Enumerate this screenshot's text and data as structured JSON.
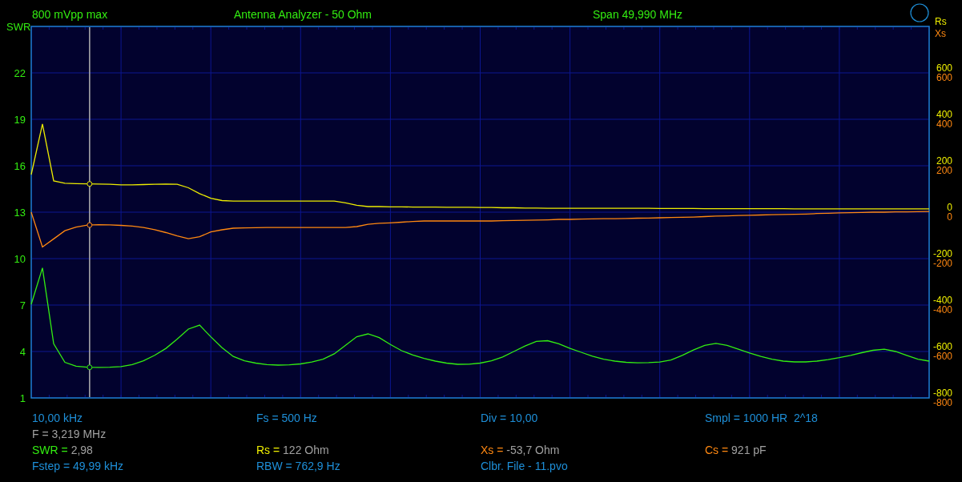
{
  "analyzer": {
    "amplitude": "800 mVpp max",
    "title": "Antenna Analyzer - 50 Ohm",
    "span": "Span 49,990 MHz",
    "cursor": {
      "level": 0.065
    },
    "swr_chart": {
      "chart_data": {
        "type": "line",
        "categories": [
          null,
          null,
          null,
          null,
          null,
          null,
          null,
          null,
          null,
          null,
          null,
          null,
          null,
          null,
          null,
          null,
          null,
          null,
          null,
          null,
          null,
          null,
          null,
          null,
          null,
          null,
          null,
          null,
          null,
          null,
          null,
          null,
          null,
          null,
          null,
          null,
          null,
          null,
          null,
          null,
          null,
          null,
          null,
          null,
          null,
          null,
          null,
          null,
          null,
          null,
          null,
          null,
          null,
          null,
          null,
          null,
          null,
          null,
          null,
          null,
          null,
          null,
          null,
          null,
          null,
          null,
          null,
          null,
          null,
          null,
          null,
          null,
          null,
          null,
          null,
          null,
          null,
          null,
          null,
          null,
          null
        ],
        "ylim": [
          1,
          25
        ],
        "yticks": [
          1,
          4,
          7,
          10,
          13,
          16,
          19,
          22
        ],
        "series": [
          {
            "name": "SWR",
            "color": "#33ee11",
            "values": [
              7.05,
              9.4,
              4.5,
              3.3,
              3.05,
              2.98,
              2.97,
              2.98,
              3.02,
              3.15,
              3.4,
              3.75,
              4.2,
              4.8,
              5.45,
              5.7,
              4.95,
              4.25,
              3.68,
              3.4,
              3.25,
              3.15,
              3.12,
              3.14,
              3.2,
              3.32,
              3.5,
              3.85,
              4.4,
              4.95,
              5.14,
              4.9,
              4.45,
              4.05,
              3.78,
              3.55,
              3.38,
              3.25,
              3.17,
              3.18,
              3.25,
              3.4,
              3.65,
              4.0,
              4.35,
              4.65,
              4.7,
              4.5,
              4.2,
              3.95,
              3.7,
              3.5,
              3.38,
              3.3,
              3.27,
              3.28,
              3.32,
              3.45,
              3.75,
              4.1,
              4.4,
              4.52,
              4.4,
              4.15,
              3.9,
              3.68,
              3.5,
              3.38,
              3.33,
              3.33,
              3.38,
              3.48,
              3.6,
              3.75,
              3.92,
              4.08,
              4.15,
              4.0,
              3.75,
              3.5,
              3.38
            ]
          }
        ]
      }
    },
    "impedance_chart": {
      "xs_tick_labels": [
        "600",
        "400",
        "200",
        "0",
        "-200",
        "-400",
        "-600",
        "-800"
      ],
      "chart_data": {
        "type": "line",
        "categories": [
          null,
          null,
          null,
          null,
          null,
          null,
          null,
          null,
          null,
          null,
          null,
          null,
          null,
          null,
          null,
          null,
          null,
          null,
          null,
          null,
          null,
          null,
          null,
          null,
          null,
          null,
          null,
          null,
          null,
          null,
          null,
          null,
          null,
          null,
          null,
          null,
          null,
          null,
          null,
          null,
          null,
          null,
          null,
          null,
          null,
          null,
          null,
          null,
          null,
          null,
          null,
          null,
          null,
          null,
          null,
          null,
          null,
          null,
          null,
          null,
          null,
          null,
          null,
          null,
          null,
          null,
          null,
          null,
          null,
          null,
          null,
          null,
          null,
          null,
          null,
          null,
          null,
          null,
          null,
          null,
          null
        ],
        "ylim": [
          -800,
          800
        ],
        "yticks": [
          -800,
          -600,
          -400,
          -200,
          0,
          200,
          400,
          600
        ],
        "series": [
          {
            "name": "Rs",
            "color": "#eeee00",
            "values": [
              162,
              380,
              135,
              125,
              123,
              122,
              121,
              120,
              118,
              118,
              119,
              120,
              121,
              120,
              105,
              80,
              60,
              50,
              48,
              48,
              48,
              48,
              48,
              48,
              48,
              48,
              48,
              48,
              40,
              30,
              24,
              24,
              23,
              23,
              22,
              22,
              22,
              21,
              21,
              21,
              20,
              20,
              19,
              19,
              18,
              18,
              17,
              17,
              17,
              17,
              17,
              17,
              17,
              17,
              17,
              17,
              16,
              16,
              16,
              16,
              15,
              15,
              15,
              15,
              15,
              15,
              15,
              15,
              14,
              14,
              14,
              14,
              14,
              14,
              14,
              14,
              14,
              14,
              14,
              14,
              14
            ]
          },
          {
            "name": "Xs",
            "color": "#ff8811",
            "values": [
              0,
              -150,
              -115,
              -80,
              -64,
              -56,
              -54,
              -55,
              -57,
              -60,
              -66,
              -75,
              -88,
              -102,
              -114,
              -106,
              -85,
              -76,
              -69,
              -68,
              -67,
              -66,
              -66,
              -66,
              -66,
              -66,
              -66,
              -66,
              -66,
              -62,
              -52,
              -48,
              -46,
              -43,
              -40,
              -38,
              -38,
              -38,
              -38,
              -38,
              -38,
              -38,
              -37,
              -36,
              -35,
              -34,
              -33,
              -31,
              -31,
              -30,
              -29,
              -28,
              -28,
              -27,
              -26,
              -25,
              -24,
              -23,
              -22,
              -21,
              -19,
              -17,
              -16,
              -14,
              -13,
              -12,
              -11,
              -10,
              -9,
              -8,
              -6,
              -5,
              -3,
              -2,
              -1,
              0,
              0,
              1,
              1,
              2,
              3
            ]
          }
        ]
      }
    }
  },
  "readouts": [
    [
      {
        "kind": "info",
        "text": "10,00 kHz"
      },
      {
        "kind": "info",
        "text": "Fs = 500 Hz"
      },
      {
        "kind": "info",
        "text": "Div = 10,00"
      },
      {
        "kind": "info",
        "text": "Smpl = 1000 HR  2^18"
      }
    ],
    [
      {
        "kind": "cursor",
        "text": "F = 3,219 MHz"
      }
    ],
    [
      {
        "kind": "reading",
        "label": "SWR =",
        "value": "2,98",
        "color": "#33ee11"
      },
      {
        "kind": "reading",
        "label": "Rs =",
        "value": "122 Ohm",
        "color": "#eeee00"
      },
      {
        "kind": "reading",
        "label": "Xs =",
        "value": "-53,7 Ohm",
        "color": "#ff8811"
      },
      {
        "kind": "reading",
        "label": "Cs =",
        "value": "921 pF",
        "color": "#ff8811"
      }
    ],
    [
      {
        "kind": "info",
        "text": "Fstep = 49,99 kHz"
      },
      {
        "kind": "info",
        "text": "RBW = 762,9 Hz"
      },
      {
        "kind": "info",
        "text": "Clbr. File - 11.pvo"
      }
    ]
  ]
}
